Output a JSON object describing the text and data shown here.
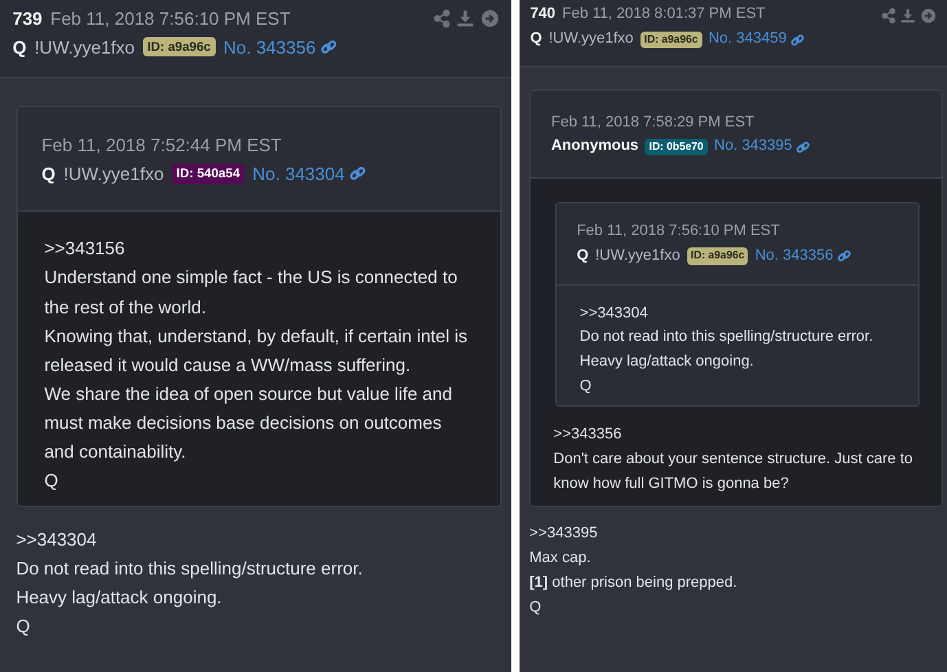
{
  "posts": [
    {
      "number": "739",
      "date": "Feb 11, 2018 7:56:10 PM EST",
      "author": "Q",
      "tripcode": "!UW.yye1fxo",
      "id": {
        "label": "ID: a9a96c",
        "color": "#b8b47c"
      },
      "post_no": "No. 343356",
      "quote": {
        "date": "Feb 11, 2018 7:52:44 PM EST",
        "author": "Q",
        "tripcode": "!UW.yye1fxo",
        "id": {
          "label": "ID: 540a54",
          "color": "#540a54"
        },
        "post_no": "No. 343304",
        "lines": [
          ">>343156",
          "Understand one simple fact - the US is connected to the rest of the world.",
          "Knowing that, understand, by default, if certain intel is released it would cause a WW/mass suffering.",
          "We share the idea of open source but value life and must make decisions base decisions on outcomes and containability.",
          "Q"
        ]
      },
      "lines": [
        ">>343304",
        "Do not read into this spelling/structure error.",
        "Heavy lag/attack ongoing.",
        "Q"
      ]
    },
    {
      "number": "740",
      "date": "Feb 11, 2018 8:01:37 PM EST",
      "author": "Q",
      "tripcode": "!UW.yye1fxo",
      "id": {
        "label": "ID: a9a96c",
        "color": "#b8b47c"
      },
      "post_no": "No. 343459",
      "quote": {
        "date": "Feb 11, 2018 7:58:29 PM EST",
        "author": "Anonymous",
        "id": {
          "label": "ID: 0b5e70",
          "color": "#0b5e70"
        },
        "post_no": "No. 343395",
        "quote": {
          "date": "Feb 11, 2018 7:56:10 PM EST",
          "author": "Q",
          "tripcode": "!UW.yye1fxo",
          "id": {
            "label": "ID: a9a96c",
            "color": "#b8b47c"
          },
          "post_no": "No. 343356",
          "lines": [
            ">>343304",
            "Do not read into this spelling/structure error.",
            "Heavy lag/attack ongoing.",
            "Q"
          ]
        },
        "lines": [
          ">>343356",
          "Don't care about your sentence structure. Just care to know how full GITMO is gonna be?"
        ]
      },
      "lines": [
        ">>343395",
        "Max cap.",
        "**[1]** other prison being prepped.",
        "Q"
      ]
    }
  ]
}
